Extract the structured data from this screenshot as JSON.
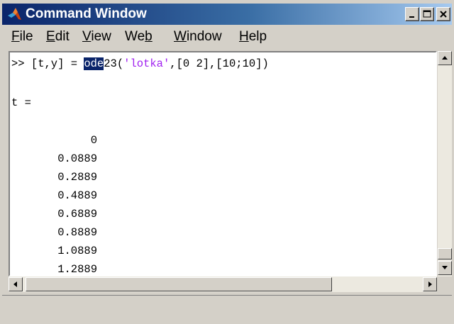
{
  "window": {
    "title": "Command Window"
  },
  "menu": {
    "items": [
      {
        "label": "File",
        "underline_index": 0
      },
      {
        "label": "Edit",
        "underline_index": 0
      },
      {
        "label": "View",
        "underline_index": 0
      },
      {
        "label": "Web",
        "underline_index": 2
      },
      {
        "label": "Window",
        "underline_index": 0
      },
      {
        "label": "Help",
        "underline_index": 0
      }
    ]
  },
  "console": {
    "prompt": ">> ",
    "command_prefix": "[t,y] = ",
    "command_selected": "ode",
    "command_func_rest": "23(",
    "command_string": "'lotka'",
    "command_args": ",[0 2],[10;10])",
    "var_label": "t =",
    "t_values": [
      "0",
      "0.0889",
      "0.2889",
      "0.4889",
      "0.6889",
      "0.8889",
      "1.0889",
      "1.2889"
    ]
  },
  "colors": {
    "selection": "#0a246a",
    "string": "#a020f0",
    "titlebar_start": "#0a246a",
    "titlebar_end": "#a6caf0"
  },
  "icons": {
    "app": "matlab-logo-icon",
    "min": "minimize-icon",
    "max": "maximize-icon",
    "close": "close-icon"
  }
}
